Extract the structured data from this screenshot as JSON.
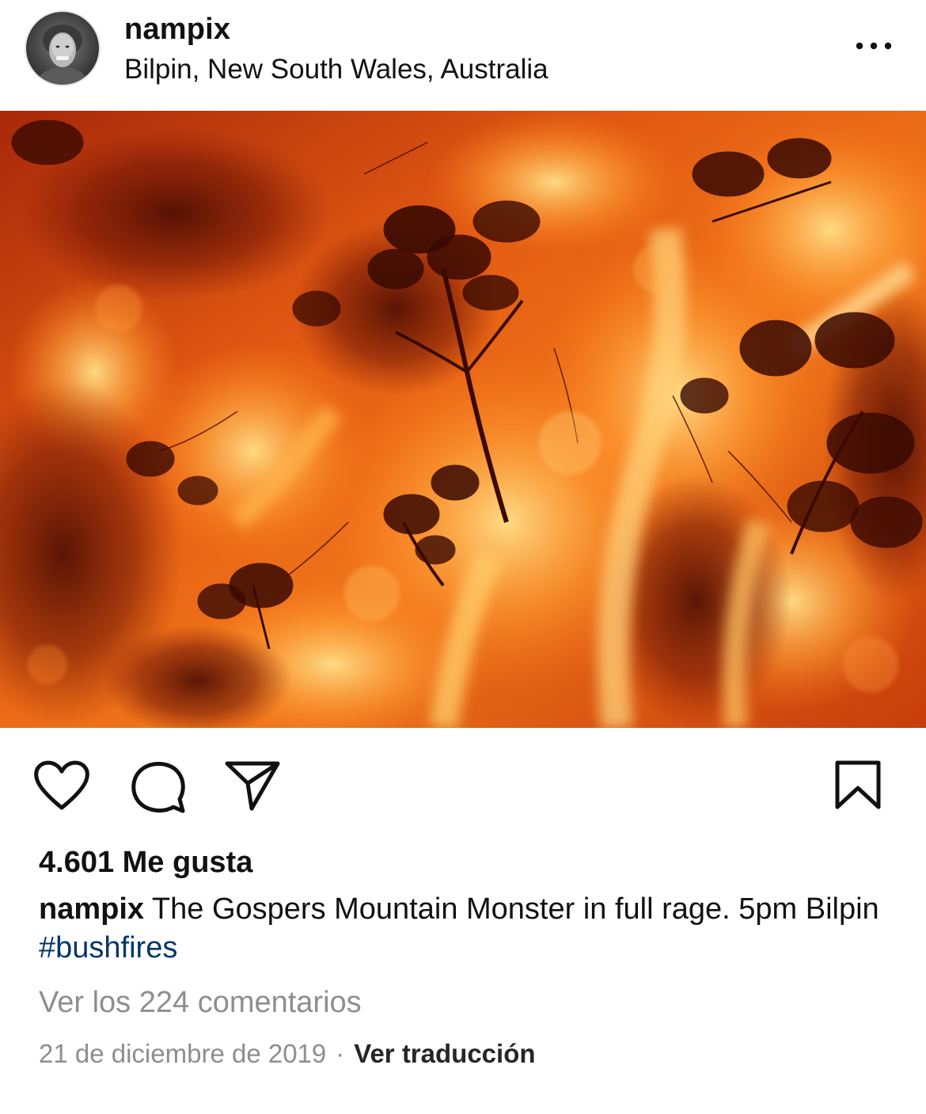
{
  "header": {
    "username": "nampix",
    "location": "Bilpin, New South Wales, Australia",
    "more_icon": "more-horizontal-icon"
  },
  "post": {
    "image_description_icon": "bushfire-photo",
    "likes": "4.601 Me gusta",
    "caption": {
      "username": "nampix",
      "text": " The Gospers Mountain Monster in full rage. 5pm Bilpin ",
      "hashtag": "#bushfires"
    },
    "view_comments": "Ver los 224 comentarios",
    "date": "21 de diciembre de 2019",
    "separator": "·",
    "translate": "Ver traducción"
  },
  "actions": {
    "like_icon": "heart-icon",
    "comment_icon": "comment-icon",
    "share_icon": "send-icon",
    "save_icon": "bookmark-icon"
  },
  "colors": {
    "hashtag": "#00376b",
    "muted_text": "#8e8e8e",
    "fire_light": "#ffb24a",
    "fire_mid": "#e8560f",
    "fire_dark": "#6e1405"
  }
}
